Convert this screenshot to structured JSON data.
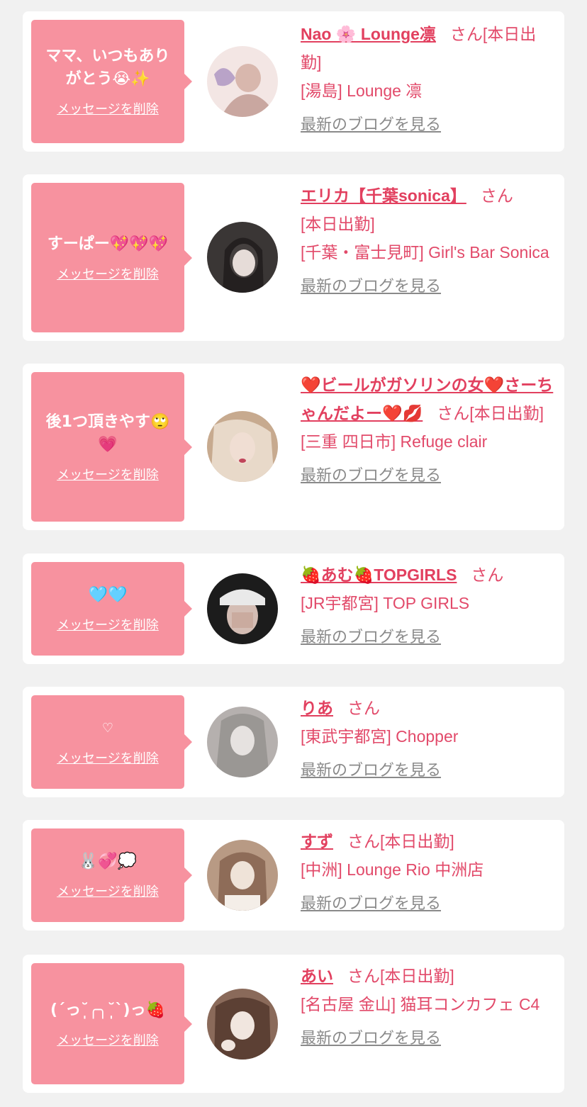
{
  "delete_label": "メッセージを削除",
  "blog_label": "最新のブログを見る",
  "san_label": "さん",
  "items": [
    {
      "message": "ママ、いつもありがとう😭✨",
      "name": "Nao 🌸 Lounge凛",
      "suffix": "[本日出勤]",
      "location": "[湯島] Lounge 凛",
      "avatar_colors": [
        "#f3e6e4",
        "#c9a7a0"
      ]
    },
    {
      "message": "すーぱー💖💖💖",
      "name": "エリカ【千葉sonica】",
      "suffix": "[本日出勤]",
      "location": "[千葉・富士見町] Girl's Bar Sonica",
      "avatar_colors": [
        "#3a3635",
        "#dcd0cc"
      ]
    },
    {
      "message": "後1つ頂きやす🙄💗",
      "name": "❤️ビールがガソリンの女❤️さーちゃんだよー❤️💋",
      "suffix": "[本日出勤]",
      "location": "[三重 四日市] Refuge clair",
      "avatar_colors": [
        "#c7aa8f",
        "#e8d9c9"
      ]
    },
    {
      "message": "🩵🩵",
      "name": "🍓あむ🍓TOPGIRLS",
      "suffix": "",
      "location": "[JR宇都宮] TOP GIRLS",
      "avatar_colors": [
        "#1c1c1c",
        "#d4bdb4"
      ]
    },
    {
      "message": "♡",
      "name": "りあ",
      "suffix": "",
      "location": "[東武宇都宮] Chopper",
      "avatar_colors": [
        "#b5b0ae",
        "#e6e2e0"
      ]
    },
    {
      "message": "🐰💞💭",
      "name": "すず",
      "suffix": "[本日出勤]",
      "location": "[中洲] Lounge Rio 中洲店",
      "avatar_colors": [
        "#b89a84",
        "#efe3d8"
      ]
    },
    {
      "message": "(ˊっ˘̩╭╮˘̩ˋ)っ🍓",
      "name": "あい",
      "suffix": "[本日出勤]",
      "location": "[名古屋 金山] 猫耳コンカフェ C4",
      "avatar_colors": [
        "#8a6a5a",
        "#f1e6df"
      ]
    }
  ]
}
